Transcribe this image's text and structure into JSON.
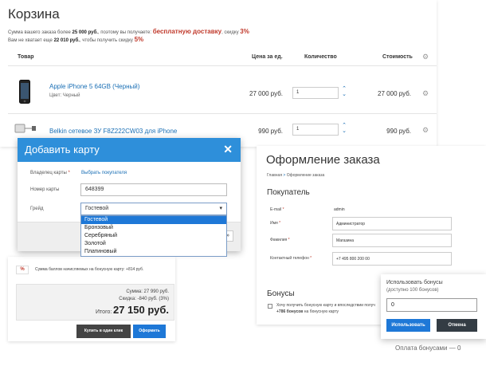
{
  "cart": {
    "title": "Корзина",
    "promo1_prefix": "Сумма вашего заказа более ",
    "promo1_amount": "25 000 руб.",
    "promo1_mid": ", поэтому вы получаете: ",
    "promo1_offer": "бесплатную доставку",
    "promo1_disc_text": ", скидку ",
    "promo1_disc": "3%",
    "promo2_prefix": "Вам не хватает еще ",
    "promo2_amount": "22 010 руб.",
    "promo2_mid": ", чтобы получить скидку ",
    "promo2_disc": "5%",
    "columns": {
      "product": "Товар",
      "price": "Цена за ед.",
      "qty": "Количество",
      "cost": "Стоимость"
    },
    "items": [
      {
        "name": "Apple iPhone 5 64GB (Черный)",
        "color_label": "Цвет: Черный",
        "price": "27 000 руб.",
        "qty": "1",
        "cost": "27 000 руб."
      },
      {
        "name": "Belkin сетевое ЗУ F8Z222CW03 для iPhone",
        "color_label": "",
        "price": "990 руб.",
        "qty": "1",
        "cost": "990 руб."
      }
    ]
  },
  "add_card_modal": {
    "title": "Добавить карту",
    "owner_label": "Владелец карты",
    "owner_link": "Выбрать покупателя",
    "number_label": "Номер карты",
    "number_value": "648399",
    "grade_label": "Грейд",
    "grade_value": "Гостевой",
    "grade_options": [
      "Гостевой",
      "Бронзовый",
      "Серебряный",
      "Золотой",
      "Платиновый"
    ]
  },
  "summary": {
    "percent_badge": "%",
    "bonus_text": "Сумма баллов начисляемых на бонусную карту: +814 руб.",
    "sum_line": "Сумма: 27 990 руб.",
    "discount_line": "Скидка: -840 руб. (3%)",
    "total_label": "Итого:",
    "total_value": "27 150 руб.",
    "one_click_button": "Купить в один клик",
    "checkout_button": "Оформить"
  },
  "checkout": {
    "title": "Оформление заказа",
    "crumb_home": "Главная",
    "crumb_sep": ">",
    "crumb_current": "Оформление заказа",
    "buyer_heading": "Покупатель",
    "email_label": "E-mail",
    "email_value": "admin",
    "name_label": "Имя",
    "name_value": "Администратор",
    "surname_label": "Фамилия",
    "surname_value": "Магазина",
    "phone_label": "Контактный телефон",
    "phone_value": "+7 495 800 200 00",
    "bonus_heading": "Бонусы",
    "bonus_checkbox_text": "Хочу получить бонусную карту и впоследствии получ",
    "bonus_checkbox_amount": "+786 бонусов",
    "bonus_checkbox_suffix": " на бонусную карту"
  },
  "bonus_popup": {
    "title": "Использовать бонусы",
    "available": "(доступно 100 бонусов)",
    "input_value": "0",
    "use_button": "Использовать",
    "cancel_button": "Отмена",
    "payment_line": "Оплата бонусами — 0"
  },
  "colors": {
    "accent": "#2e8fda",
    "link": "#1a6fb5",
    "danger": "#c0392b",
    "dark_button": "#444444"
  }
}
